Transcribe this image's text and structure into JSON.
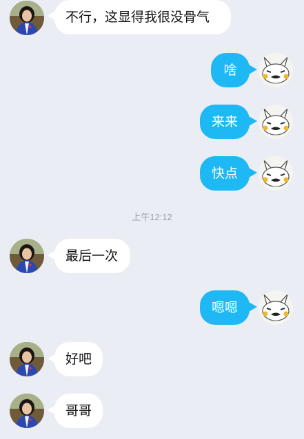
{
  "messages": [
    {
      "side": "incoming",
      "text": "不行，这显得我很没骨气"
    },
    {
      "side": "outgoing",
      "text": "啥"
    },
    {
      "side": "outgoing",
      "text": "来来"
    },
    {
      "side": "outgoing",
      "text": "快点"
    },
    {
      "side": "incoming",
      "text": "最后一次"
    },
    {
      "side": "outgoing",
      "text": "嗯嗯"
    },
    {
      "side": "incoming",
      "text": "好吧"
    },
    {
      "side": "incoming",
      "text": "哥哥"
    }
  ],
  "timestamp": "上午12:12",
  "colors": {
    "background": "#ebedf4",
    "incoming_bubble": "#ffffff",
    "outgoing_bubble": "#1eb8f4",
    "timestamp_text": "#9a9ea8"
  },
  "icons": {
    "contact_avatar": "girl-in-blue-jacket-avatar",
    "self_avatar": "pikachu-sticker-avatar"
  }
}
